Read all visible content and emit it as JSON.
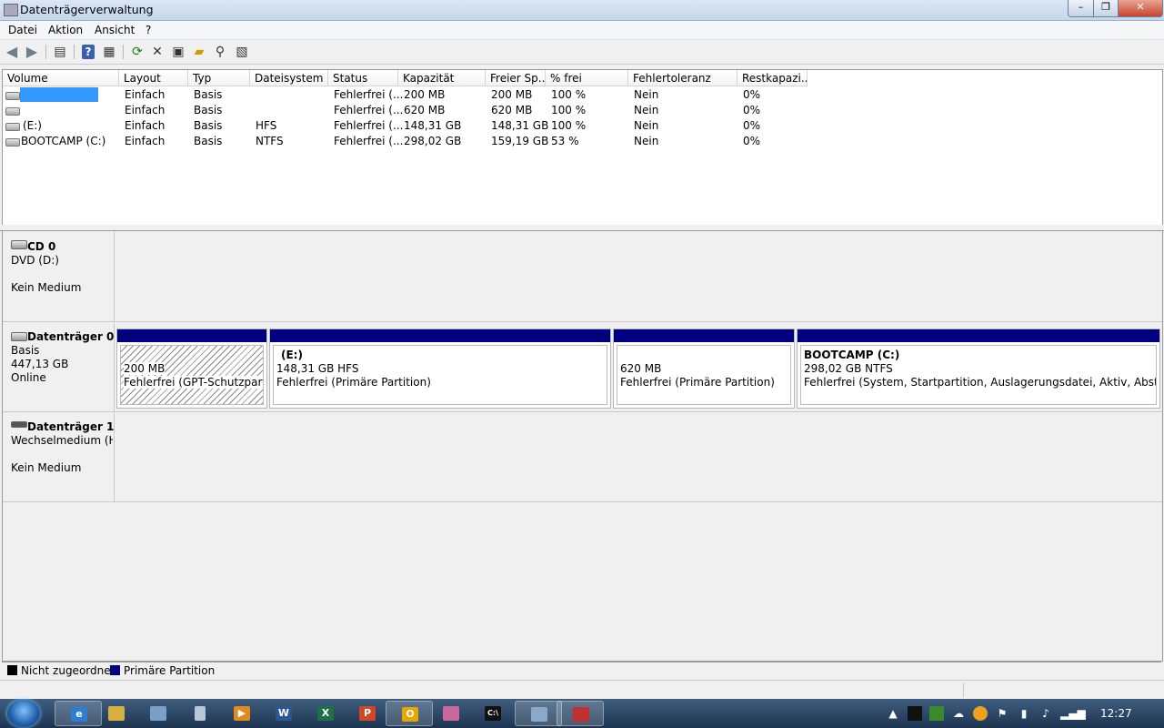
{
  "window": {
    "title": "Datenträgerverwaltung",
    "min_label": "–",
    "max_label": "❐",
    "close_label": "✕"
  },
  "menu": [
    "Datei",
    "Aktion",
    "Ansicht",
    "?"
  ],
  "toolbar": {
    "icons": [
      "back-arrow-icon",
      "forward-arrow-icon",
      "show-hide-console-icon",
      "help-icon",
      "show-pane-icon",
      "refresh-icon",
      "delete-icon",
      "properties-icon",
      "open-icon",
      "explore-icon",
      "help-topics-icon"
    ],
    "help_glyph": "?",
    "delete_glyph": "✕"
  },
  "volume_list": {
    "columns": [
      "Volume",
      "Layout",
      "Typ",
      "Dateisystem",
      "Status",
      "Kapazität",
      "Freier Sp...",
      "% frei",
      "Fehlertoleranz",
      "Restkapazi..."
    ],
    "rows": [
      {
        "volume": "",
        "layout": "Einfach",
        "typ": "Basis",
        "fs": "",
        "status": "Fehlerfrei (...",
        "cap": "200 MB",
        "free": "200 MB",
        "pct": "100 %",
        "ft": "Nein",
        "rest": "0%",
        "selected": true
      },
      {
        "volume": "",
        "layout": "Einfach",
        "typ": "Basis",
        "fs": "",
        "status": "Fehlerfrei (...",
        "cap": "620 MB",
        "free": "620 MB",
        "pct": "100 %",
        "ft": "Nein",
        "rest": "0%"
      },
      {
        "volume": "(E:)",
        "layout": "Einfach",
        "typ": "Basis",
        "fs": "HFS",
        "status": "Fehlerfrei (...",
        "cap": "148,31 GB",
        "free": "148,31 GB",
        "pct": "100 %",
        "ft": "Nein",
        "rest": "0%"
      },
      {
        "volume": "BOOTCAMP (C:)",
        "layout": "Einfach",
        "typ": "Basis",
        "fs": "NTFS",
        "status": "Fehlerfrei (...",
        "cap": "298,02 GB",
        "free": "159,19 GB",
        "pct": "53 %",
        "ft": "Nein",
        "rest": "0%"
      }
    ]
  },
  "disks": {
    "cd0": {
      "name": "CD 0",
      "line1": "DVD (D:)",
      "line2": "Kein Medium"
    },
    "disk0": {
      "name": "Datenträger 0",
      "line1": "Basis",
      "line2": "447,13 GB",
      "line3": "Online",
      "partitions": [
        {
          "title": "",
          "size": "200 MB",
          "status": "Fehlerfrei (GPT-Schutzpartition)"
        },
        {
          "title": "(E:)",
          "size": "148,31 GB HFS",
          "status": "Fehlerfrei (Primäre Partition)"
        },
        {
          "title": "",
          "size": "620 MB",
          "status": "Fehlerfrei (Primäre Partition)"
        },
        {
          "title": "BOOTCAMP  (C:)",
          "size": "298,02 GB NTFS",
          "status": "Fehlerfrei (System, Startpartition, Auslagerungsdatei, Aktiv, Absturzabbild"
        }
      ]
    },
    "disk1": {
      "name": "Datenträger 1",
      "line1": "Wechselmedium (H",
      "line2": "Kein Medium"
    }
  },
  "legend": {
    "unallocated": "Nicht zugeordnet",
    "primary": "Primäre Partition",
    "unallocated_color": "#000000",
    "primary_color": "#000080"
  },
  "taskbar": {
    "apps": [
      "internet-explorer-icon",
      "explorer-folder-icon",
      "paint-icon",
      "calculator-icon",
      "media-player-icon",
      "word-icon",
      "excel-icon",
      "powerpoint-icon",
      "outlook-icon",
      "paint-app-icon",
      "cmd-icon",
      "computer-management-icon",
      "disk-management-icon"
    ],
    "word_glyph": "W",
    "excel_glyph": "X",
    "powerpoint_glyph": "P",
    "outlook_glyph": "O",
    "cmd_glyph": "C:\\",
    "clock": "12:27"
  }
}
